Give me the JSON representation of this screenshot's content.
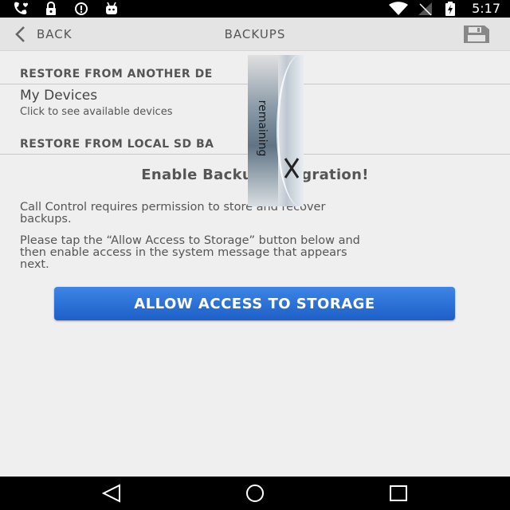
{
  "status_bar": {
    "time": "5:17",
    "left_icons": [
      "phone-heart-icon",
      "lock-icon",
      "info-icon",
      "android-icon"
    ],
    "right_icons": [
      "wifi-icon",
      "signal-icon",
      "battery-charging-icon"
    ]
  },
  "app_bar": {
    "back_label": "BACK",
    "title": "BACKUPS",
    "save_icon": "save-icon"
  },
  "sections": {
    "another_device_header": "RESTORE FROM ANOTHER DE",
    "device_title": "My Devices",
    "device_subtitle": "Click to see available devices",
    "local_sd_header": "RESTORE FROM LOCAL SD BA"
  },
  "permission": {
    "title": "Enable Backup Integration!",
    "paragraph_1_line_1": "Call Control requires permission to store and recover",
    "paragraph_1_line_2": "backups.",
    "paragraph_2_line_1": "Please tap the “Allow Access to Storage” button below and",
    "paragraph_2_line_2": "then enable access in the system message that appears",
    "paragraph_2_line_3": "next.",
    "button_label": "ALLOW ACCESS TO STORAGE",
    "button_color": "#2a6fd6"
  },
  "ad_overlay": {
    "text": "remaining",
    "close_icon": "close-icon"
  },
  "nav_bar": {
    "items": [
      "back-triangle-icon",
      "home-circle-icon",
      "recents-square-icon"
    ]
  },
  "colors": {
    "background": "#efefef",
    "app_bar": "#e4e4e4",
    "text": "#555555",
    "button": "#2a6fd6"
  }
}
